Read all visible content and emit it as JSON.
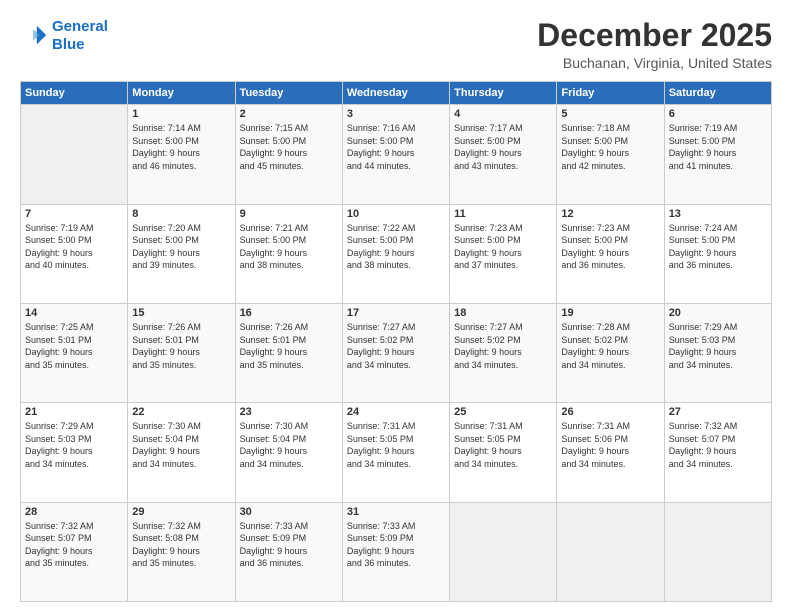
{
  "header": {
    "logo_line1": "General",
    "logo_line2": "Blue",
    "title": "December 2025",
    "subtitle": "Buchanan, Virginia, United States"
  },
  "days_of_week": [
    "Sunday",
    "Monday",
    "Tuesday",
    "Wednesday",
    "Thursday",
    "Friday",
    "Saturday"
  ],
  "weeks": [
    [
      {
        "num": "",
        "info": ""
      },
      {
        "num": "1",
        "info": "Sunrise: 7:14 AM\nSunset: 5:00 PM\nDaylight: 9 hours\nand 46 minutes."
      },
      {
        "num": "2",
        "info": "Sunrise: 7:15 AM\nSunset: 5:00 PM\nDaylight: 9 hours\nand 45 minutes."
      },
      {
        "num": "3",
        "info": "Sunrise: 7:16 AM\nSunset: 5:00 PM\nDaylight: 9 hours\nand 44 minutes."
      },
      {
        "num": "4",
        "info": "Sunrise: 7:17 AM\nSunset: 5:00 PM\nDaylight: 9 hours\nand 43 minutes."
      },
      {
        "num": "5",
        "info": "Sunrise: 7:18 AM\nSunset: 5:00 PM\nDaylight: 9 hours\nand 42 minutes."
      },
      {
        "num": "6",
        "info": "Sunrise: 7:19 AM\nSunset: 5:00 PM\nDaylight: 9 hours\nand 41 minutes."
      }
    ],
    [
      {
        "num": "7",
        "info": "Sunrise: 7:19 AM\nSunset: 5:00 PM\nDaylight: 9 hours\nand 40 minutes."
      },
      {
        "num": "8",
        "info": "Sunrise: 7:20 AM\nSunset: 5:00 PM\nDaylight: 9 hours\nand 39 minutes."
      },
      {
        "num": "9",
        "info": "Sunrise: 7:21 AM\nSunset: 5:00 PM\nDaylight: 9 hours\nand 38 minutes."
      },
      {
        "num": "10",
        "info": "Sunrise: 7:22 AM\nSunset: 5:00 PM\nDaylight: 9 hours\nand 38 minutes."
      },
      {
        "num": "11",
        "info": "Sunrise: 7:23 AM\nSunset: 5:00 PM\nDaylight: 9 hours\nand 37 minutes."
      },
      {
        "num": "12",
        "info": "Sunrise: 7:23 AM\nSunset: 5:00 PM\nDaylight: 9 hours\nand 36 minutes."
      },
      {
        "num": "13",
        "info": "Sunrise: 7:24 AM\nSunset: 5:00 PM\nDaylight: 9 hours\nand 36 minutes."
      }
    ],
    [
      {
        "num": "14",
        "info": "Sunrise: 7:25 AM\nSunset: 5:01 PM\nDaylight: 9 hours\nand 35 minutes."
      },
      {
        "num": "15",
        "info": "Sunrise: 7:26 AM\nSunset: 5:01 PM\nDaylight: 9 hours\nand 35 minutes."
      },
      {
        "num": "16",
        "info": "Sunrise: 7:26 AM\nSunset: 5:01 PM\nDaylight: 9 hours\nand 35 minutes."
      },
      {
        "num": "17",
        "info": "Sunrise: 7:27 AM\nSunset: 5:02 PM\nDaylight: 9 hours\nand 34 minutes."
      },
      {
        "num": "18",
        "info": "Sunrise: 7:27 AM\nSunset: 5:02 PM\nDaylight: 9 hours\nand 34 minutes."
      },
      {
        "num": "19",
        "info": "Sunrise: 7:28 AM\nSunset: 5:02 PM\nDaylight: 9 hours\nand 34 minutes."
      },
      {
        "num": "20",
        "info": "Sunrise: 7:29 AM\nSunset: 5:03 PM\nDaylight: 9 hours\nand 34 minutes."
      }
    ],
    [
      {
        "num": "21",
        "info": "Sunrise: 7:29 AM\nSunset: 5:03 PM\nDaylight: 9 hours\nand 34 minutes."
      },
      {
        "num": "22",
        "info": "Sunrise: 7:30 AM\nSunset: 5:04 PM\nDaylight: 9 hours\nand 34 minutes."
      },
      {
        "num": "23",
        "info": "Sunrise: 7:30 AM\nSunset: 5:04 PM\nDaylight: 9 hours\nand 34 minutes."
      },
      {
        "num": "24",
        "info": "Sunrise: 7:31 AM\nSunset: 5:05 PM\nDaylight: 9 hours\nand 34 minutes."
      },
      {
        "num": "25",
        "info": "Sunrise: 7:31 AM\nSunset: 5:05 PM\nDaylight: 9 hours\nand 34 minutes."
      },
      {
        "num": "26",
        "info": "Sunrise: 7:31 AM\nSunset: 5:06 PM\nDaylight: 9 hours\nand 34 minutes."
      },
      {
        "num": "27",
        "info": "Sunrise: 7:32 AM\nSunset: 5:07 PM\nDaylight: 9 hours\nand 34 minutes."
      }
    ],
    [
      {
        "num": "28",
        "info": "Sunrise: 7:32 AM\nSunset: 5:07 PM\nDaylight: 9 hours\nand 35 minutes."
      },
      {
        "num": "29",
        "info": "Sunrise: 7:32 AM\nSunset: 5:08 PM\nDaylight: 9 hours\nand 35 minutes."
      },
      {
        "num": "30",
        "info": "Sunrise: 7:33 AM\nSunset: 5:09 PM\nDaylight: 9 hours\nand 36 minutes."
      },
      {
        "num": "31",
        "info": "Sunrise: 7:33 AM\nSunset: 5:09 PM\nDaylight: 9 hours\nand 36 minutes."
      },
      {
        "num": "",
        "info": ""
      },
      {
        "num": "",
        "info": ""
      },
      {
        "num": "",
        "info": ""
      }
    ]
  ]
}
